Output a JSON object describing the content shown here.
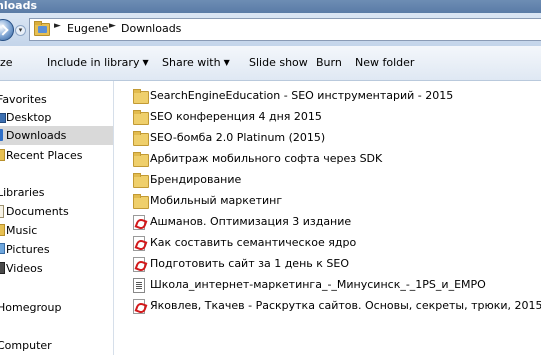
{
  "window": {
    "title": "nloads"
  },
  "address": {
    "crumbs": [
      "Eugene",
      "Downloads"
    ]
  },
  "toolbar": {
    "organize": "ze",
    "include_in_library": "Include in library",
    "share_with": "Share with",
    "slide_show": "Slide show",
    "burn": "Burn",
    "new_folder": "New folder"
  },
  "nav": {
    "favorites": "Favorites",
    "desktop": "Desktop",
    "downloads": "Downloads",
    "recent_places": "Recent Places",
    "libraries": "Libraries",
    "documents": "Documents",
    "music": "Music",
    "pictures": "Pictures",
    "videos": "Videos",
    "homegroup": "Homegroup",
    "computer": "Computer"
  },
  "files": [
    {
      "name": "SearchEngineEducation - SEO инструментарий - 2015",
      "type": "folder"
    },
    {
      "name": "SEO конференция 4 дня 2015",
      "type": "folder"
    },
    {
      "name": "SEO-бомба 2.0 Platinum (2015)",
      "type": "folder"
    },
    {
      "name": "Арбитраж мобильного софта через SDK",
      "type": "folder"
    },
    {
      "name": "Брендирование",
      "type": "folder"
    },
    {
      "name": "Мобильный маркетинг",
      "type": "folder"
    },
    {
      "name": "Ашманов. Оптимизация 3 издание",
      "type": "pdf"
    },
    {
      "name": "Как составить семантическое ядро",
      "type": "pdf"
    },
    {
      "name": "Подготовить сайт за 1 день к SEO",
      "type": "pdf"
    },
    {
      "name": "Школа_интернет-маркетинга_-_Минусинск_-_1PS_и_EMPO",
      "type": "doc"
    },
    {
      "name": "Яковлев, Ткачев - Раскрутка сайтов. Основы, секреты, трюки, 2015",
      "type": "pdf"
    }
  ]
}
